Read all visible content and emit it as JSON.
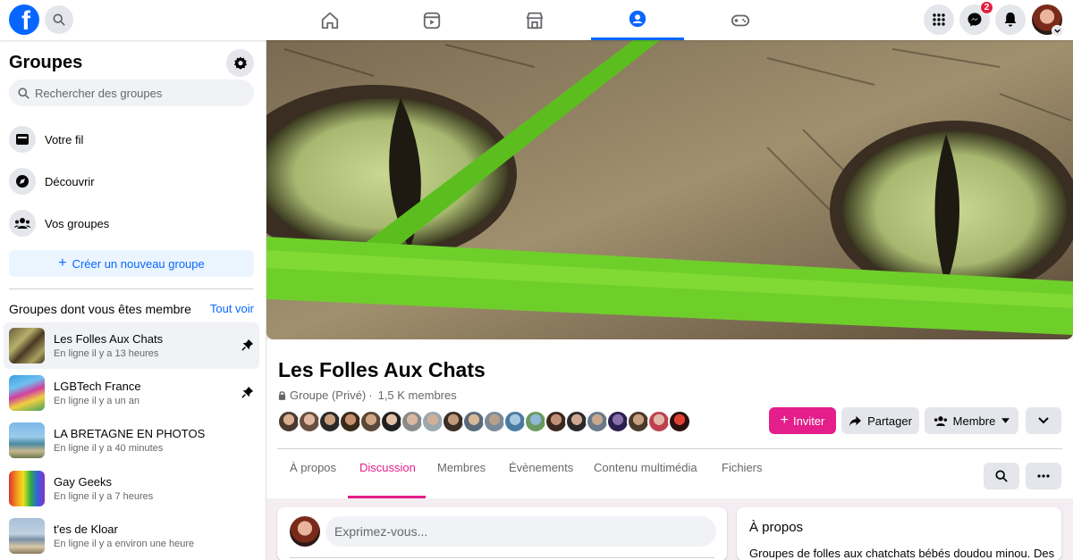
{
  "colors": {
    "brand": "#0866ff",
    "group_accent": "#e41e8a",
    "notification_badge": "#e41e3f"
  },
  "topbar": {
    "logo_letter": "f",
    "nav_tabs": [
      "home-icon",
      "video-icon",
      "marketplace-icon",
      "groups-icon",
      "gaming-icon"
    ],
    "active_tab": "groups-icon",
    "messenger_badge": "2"
  },
  "sidebar": {
    "title": "Groupes",
    "search_placeholder": "Rechercher des groupes",
    "nav": [
      {
        "label": "Votre fil",
        "icon": "feed-icon"
      },
      {
        "label": "Découvrir",
        "icon": "discover-icon"
      },
      {
        "label": "Vos groupes",
        "icon": "your-groups-icon"
      }
    ],
    "create_label": "Créer un nouveau groupe",
    "section_title": "Groupes dont vous êtes membre",
    "see_all": "Tout voir",
    "groups": [
      {
        "name": "Les Folles Aux Chats",
        "status": "En ligne il y a 13 heures",
        "pinned": true
      },
      {
        "name": "LGBTech France",
        "status": "En ligne il y a un an",
        "pinned": true
      },
      {
        "name": "LA BRETAGNE EN PHOTOS",
        "status": "En ligne il y a 40 minutes",
        "pinned": false
      },
      {
        "name": "Gay Geeks",
        "status": "En ligne il y a 7 heures",
        "pinned": false
      },
      {
        "name": "t'es de Kloar",
        "status": "En ligne il y a environ une heure",
        "pinned": false
      }
    ]
  },
  "group": {
    "title": "Les Folles Aux Chats",
    "privacy": "Groupe (Privé)",
    "separator": "·",
    "members_count": "1,5 K membres",
    "invite_label": "Inviter",
    "share_label": "Partager",
    "member_label": "Membre",
    "tabs": [
      "À propos",
      "Discussion",
      "Membres",
      "Évènements",
      "Contenu multimédia",
      "Fichiers"
    ],
    "active_tab": "Discussion"
  },
  "composer": {
    "placeholder": "Exprimez-vous..."
  },
  "about": {
    "title": "À propos",
    "text": "Groupes de folles aux chatchats bébés doudou minou. Des"
  }
}
